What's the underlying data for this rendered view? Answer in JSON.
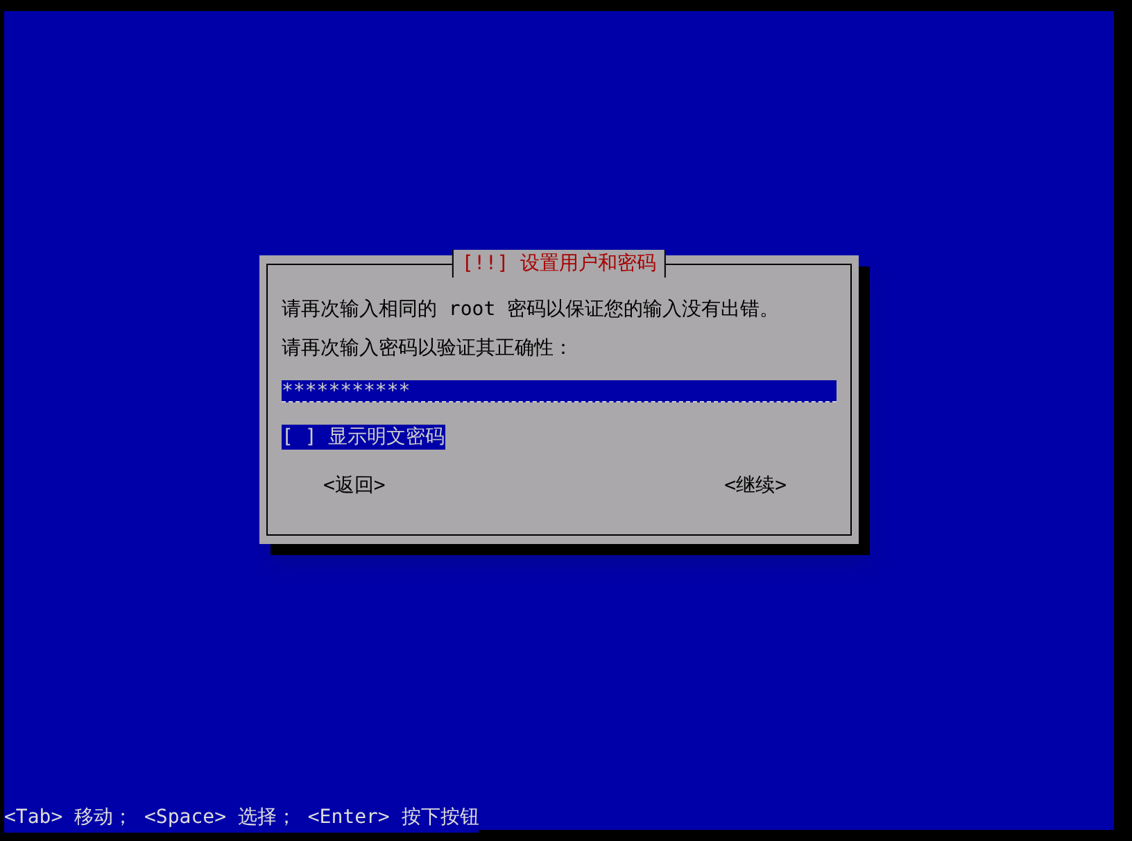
{
  "dialog": {
    "title": "[!!] 设置用户和密码",
    "message": "请再次输入相同的 root 密码以保证您的输入没有出错。",
    "prompt": "请再次输入密码以验证其正确性：",
    "password_field": {
      "value": "***********"
    },
    "checkbox": {
      "label": "显示明文密码",
      "checked": false,
      "box": "[ ]",
      "focused": true
    },
    "buttons": [
      {
        "label": "<返回>"
      },
      {
        "label": "<继续>"
      }
    ]
  },
  "status_bar": "<Tab> 移动； <Space> 选择； <Enter> 按下按钮"
}
